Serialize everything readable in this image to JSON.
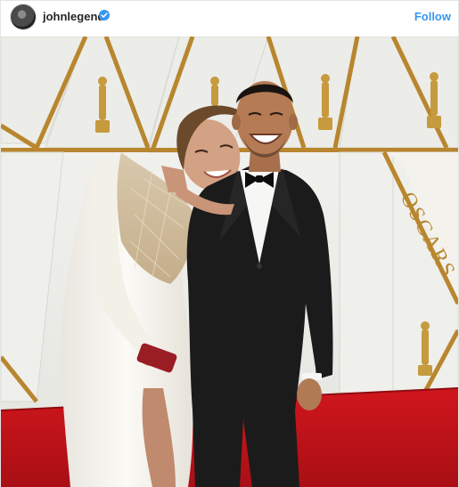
{
  "post": {
    "username": "johnlegend",
    "verified": true,
    "follow_label": "Follow",
    "avatar_icon": "profile-photo",
    "verified_icon": "verified-badge-icon",
    "photo": {
      "backdrop_text": "OSCARS",
      "colors": {
        "carpet": "#c8141b",
        "backdrop": "#f0f0ec",
        "gold": "#b8862e",
        "tuxedo": "#1a1a1a",
        "gown": "#f4f1ea"
      }
    }
  },
  "colors": {
    "accent": "#3897f0",
    "text": "#262626"
  }
}
